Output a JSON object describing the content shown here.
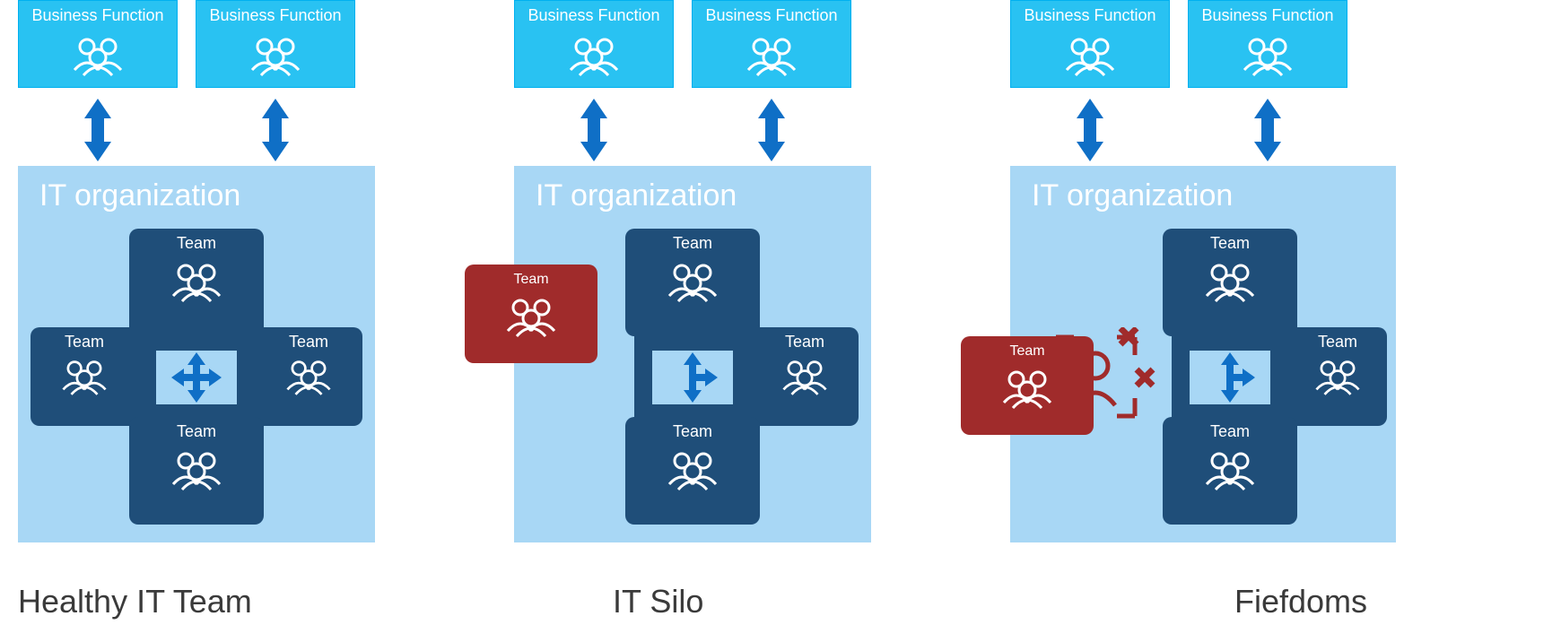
{
  "colors": {
    "light_blue_box": "#29C2F2",
    "light_blue_bg": "#A8D7F5",
    "dark_blue": "#1F4E79",
    "arrow_blue": "#0F6FC6",
    "red": "#A02B2B",
    "x_red": "#C0392B"
  },
  "labels": {
    "business_function": "Business Function",
    "it_organization": "IT organization",
    "team": "Team"
  },
  "panels": [
    {
      "id": "healthy",
      "caption": "Healthy IT Team",
      "business_functions": 2,
      "silo": false,
      "blocked": false,
      "team_left_present": true
    },
    {
      "id": "silo",
      "caption": "IT Silo",
      "business_functions": 2,
      "silo": true,
      "blocked": false,
      "team_left_present": false
    },
    {
      "id": "fiefdoms",
      "caption": "Fiefdoms",
      "business_functions": 2,
      "silo": true,
      "blocked": true,
      "team_left_present": false
    }
  ]
}
